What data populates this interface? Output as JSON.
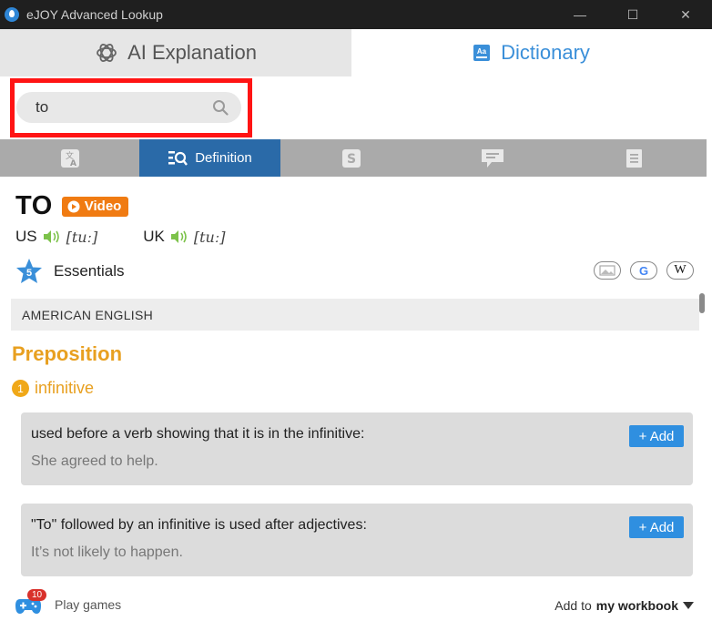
{
  "window": {
    "title": "eJOY Advanced Lookup",
    "minimize": "—",
    "maximize": "☐",
    "close": "✕"
  },
  "top_tabs": {
    "ai": "AI Explanation",
    "dictionary": "Dictionary"
  },
  "search": {
    "value": "to"
  },
  "sub_tabs": {
    "definition": "Definition"
  },
  "entry": {
    "word": "TO",
    "video_label": "Video",
    "pronunciations": [
      {
        "region": "US",
        "ipa": "[tuː]"
      },
      {
        "region": "UK",
        "ipa": "[tuː]"
      }
    ],
    "level_number": "5",
    "level_label": "Essentials",
    "region_header": "AMERICAN ENGLISH",
    "part_of_speech": "Preposition",
    "sense_number": "1",
    "sense_label": "infinitive",
    "definitions": [
      {
        "text": "used before a verb showing that it is in the infinitive:",
        "example": "She agreed to help.",
        "add": "+ Add"
      },
      {
        "text": "\"To\" followed by an infinitive is used after adjectives:",
        "example": "It’s not likely to happen.",
        "add": "+ Add"
      }
    ]
  },
  "bottom": {
    "games_count": "10",
    "games_label": "Play games",
    "workbook_prefix": "Add to",
    "workbook_name": "my workbook"
  },
  "colors": {
    "accent_blue": "#3a8fd9",
    "active_tab": "#2a6aa8",
    "orange": "#f07b12",
    "highlight_red": "#ff1414"
  }
}
